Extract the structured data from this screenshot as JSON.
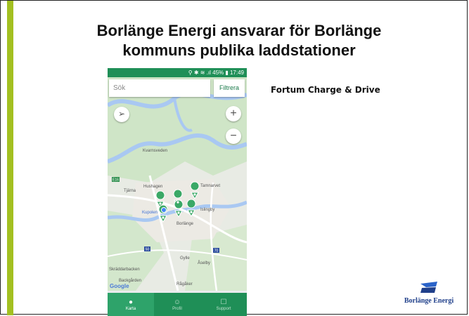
{
  "slide": {
    "title_line1": "Borlänge Energi ansvarar för Borlänge",
    "title_line2": "kommuns publika laddstationer",
    "side_text": "Fortum Charge & Drive",
    "accent_color": "#a3c021"
  },
  "phone": {
    "status_bar": "⚲ ✱ ≋ .ıl 45% ▮ 17:49",
    "search_placeholder": "Sök",
    "filter_label": "Filtrera",
    "map_labels": {
      "kvarnsveden": "Kvarnsveden",
      "tjarna": "Tjärna",
      "hushagen": "Hushagen",
      "tamnarvet": "Tamnarvet",
      "islingby": "Islingby",
      "kupolen": "Kupolen",
      "borlange": "Borlänge",
      "gylle": "Gylle",
      "aselby": "Åselby",
      "skraddarbacken": "Skräddarbacken",
      "backgarden": "Backgården",
      "ragaker": "Rågåker",
      "google": "Google",
      "road_e16": "E16",
      "road_50": "50",
      "road_70": "70"
    },
    "nav": [
      {
        "label": "Karta",
        "icon": "map-pin-icon",
        "active": true
      },
      {
        "label": "Profil",
        "icon": "profile-icon",
        "active": false
      },
      {
        "label": "Support",
        "icon": "chat-icon",
        "active": false
      }
    ]
  },
  "logo": {
    "text": "Borlänge Energi",
    "color": "#1f3f8a"
  }
}
